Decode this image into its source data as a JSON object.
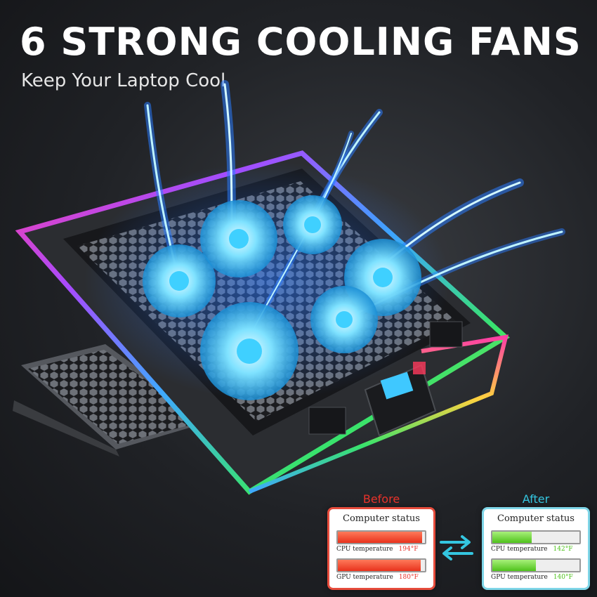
{
  "headline": "6 STRONG COOLING FANS",
  "subheadline": "Keep Your Laptop Cool",
  "device": {
    "fan_count": 6,
    "icons": [
      "fan-icon",
      "rgb-light-strip",
      "lcd-display",
      "control-button"
    ],
    "accent_colors": {
      "fan_glow": "#3fd0ff",
      "airflow": "#2a7bff",
      "rgb": [
        "#ff3ea5",
        "#a64bff",
        "#3fa9ff",
        "#39e36b",
        "#ffd23f"
      ]
    },
    "display_color": "#3fc8ff"
  },
  "comparison": {
    "before": {
      "label": "Before",
      "title": "Computer status",
      "cpu_label": "CPU temperature",
      "cpu_value": "194°F",
      "cpu_level": 0.97,
      "gpu_label": "GPU temperature",
      "gpu_value": "180°F",
      "gpu_level": 0.95,
      "color": "#e8322a"
    },
    "after": {
      "label": "After",
      "title": "Computer status",
      "cpu_label": "CPU temperature",
      "cpu_value": "142°F",
      "cpu_level": 0.45,
      "gpu_label": "GPU temperature",
      "gpu_value": "140°F",
      "gpu_level": 0.5,
      "color": "#34c6e0"
    },
    "swap_icon": "swap-arrows-icon"
  }
}
